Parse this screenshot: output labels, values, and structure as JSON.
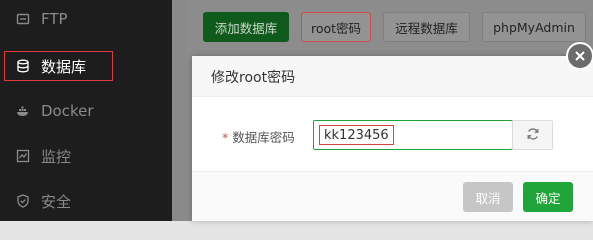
{
  "sidebar": {
    "items": [
      {
        "label": "FTP",
        "icon": "ftp-icon",
        "active": false
      },
      {
        "label": "数据库",
        "icon": "database-icon",
        "active": true
      },
      {
        "label": "Docker",
        "icon": "docker-icon",
        "active": false
      },
      {
        "label": "监控",
        "icon": "monitor-icon",
        "active": false
      },
      {
        "label": "安全",
        "icon": "shield-icon",
        "active": false
      }
    ]
  },
  "toolbar": {
    "add_db_label": "添加数据库",
    "root_pwd_label": "root密码",
    "remote_db_label": "远程数据库",
    "phpmyadmin_label": "phpMyAdmin"
  },
  "modal": {
    "title": "修改root密码",
    "required_mark": "*",
    "field_label": "数据库密码",
    "field_value": "kk123456",
    "cancel_label": "取消",
    "confirm_label": "确定"
  },
  "colors": {
    "accent": "#20a53a",
    "highlight": "#e03b3b",
    "sidebar_bg": "#1d1d1d"
  }
}
